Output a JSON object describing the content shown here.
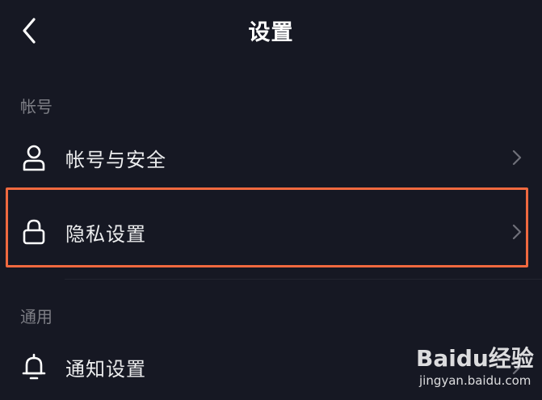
{
  "header": {
    "title": "设置",
    "back_icon": "chevron-left-icon"
  },
  "sections": [
    {
      "label": "帐号"
    },
    {
      "label": "通用"
    }
  ],
  "items": [
    {
      "label": "帐号与安全",
      "icon": "user-icon"
    },
    {
      "label": "隐私设置",
      "icon": "lock-icon"
    },
    {
      "label": "通知设置",
      "icon": "bell-icon"
    }
  ],
  "highlight_color": "#f0693f",
  "watermark": {
    "main": "Baidu经验",
    "sub": "jingyan.baidu.com"
  }
}
